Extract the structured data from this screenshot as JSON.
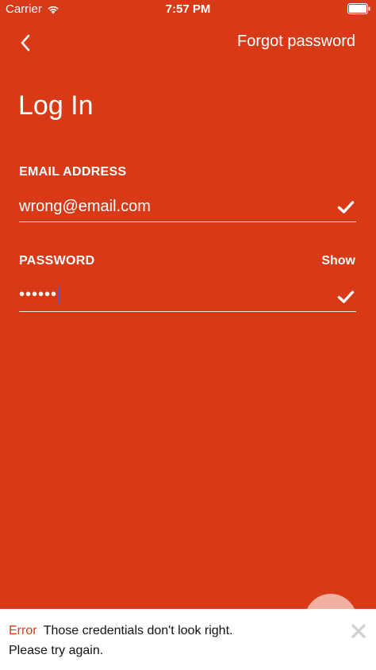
{
  "status_bar": {
    "carrier": "Carrier",
    "time": "7:57 PM"
  },
  "nav": {
    "back_icon": "chevron-left-icon",
    "forgot_password": "Forgot password"
  },
  "title": "Log In",
  "email": {
    "label": "EMAIL ADDRESS",
    "value": "wrong@email.com",
    "valid_icon": "checkmark-icon"
  },
  "password": {
    "label": "PASSWORD",
    "show_label": "Show",
    "masked_value": "••••••",
    "valid_icon": "checkmark-icon"
  },
  "snackbar": {
    "error_label": "Error",
    "message_line1": "Those credentials don't look right.",
    "message_line2": "Please try again.",
    "dismiss_icon": "close-icon"
  },
  "colors": {
    "background": "#d83a18",
    "text": "#ffffff",
    "error": "#d83a18",
    "snackbar_bg": "#ffffff"
  }
}
